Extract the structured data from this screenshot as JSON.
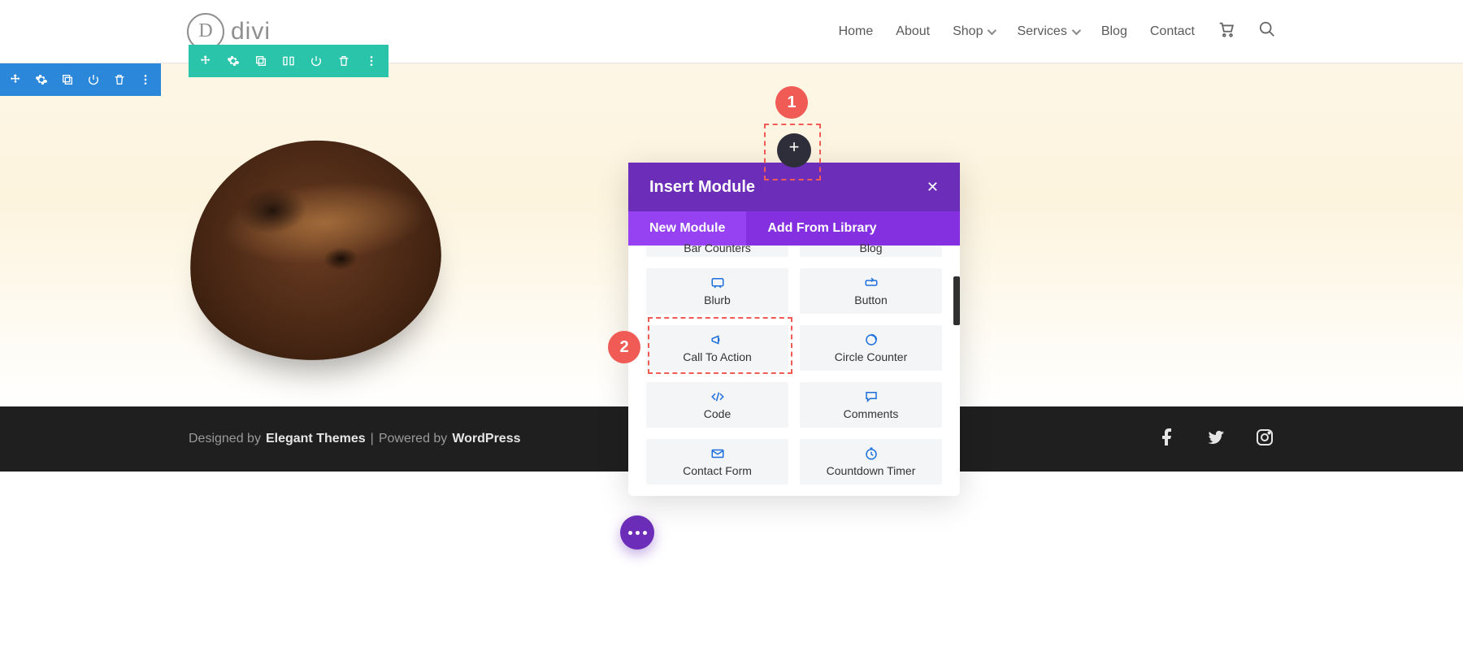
{
  "header": {
    "logo_letter": "D",
    "logo_text": "divi",
    "nav": [
      "Home",
      "About",
      "Shop",
      "Services",
      "Blog",
      "Contact"
    ]
  },
  "section_toolbar_icons": [
    "move",
    "gear",
    "duplicate",
    "power",
    "trash",
    "more"
  ],
  "row_toolbar_icons": [
    "move",
    "gear",
    "duplicate",
    "columns",
    "power",
    "trash",
    "more"
  ],
  "callouts": {
    "one": "1",
    "two": "2"
  },
  "add_button_glyph": "+",
  "modal": {
    "title": "Insert Module",
    "close_glyph": "✕",
    "tabs": {
      "new": "New Module",
      "library": "Add From Library"
    },
    "top_row": [
      "Bar Counters",
      "Blog"
    ],
    "items": [
      {
        "label": "Blurb",
        "icon": "blurb"
      },
      {
        "label": "Button",
        "icon": "button"
      },
      {
        "label": "Call To Action",
        "icon": "cta"
      },
      {
        "label": "Circle Counter",
        "icon": "circle-counter"
      },
      {
        "label": "Code",
        "icon": "code"
      },
      {
        "label": "Comments",
        "icon": "comments"
      },
      {
        "label": "Contact Form",
        "icon": "contact"
      },
      {
        "label": "Countdown Timer",
        "icon": "countdown"
      }
    ]
  },
  "footer": {
    "designed_by": "Designed by",
    "et": "Elegant Themes",
    "sep": " | ",
    "powered_by": "Powered by",
    "wp": "WordPress"
  }
}
